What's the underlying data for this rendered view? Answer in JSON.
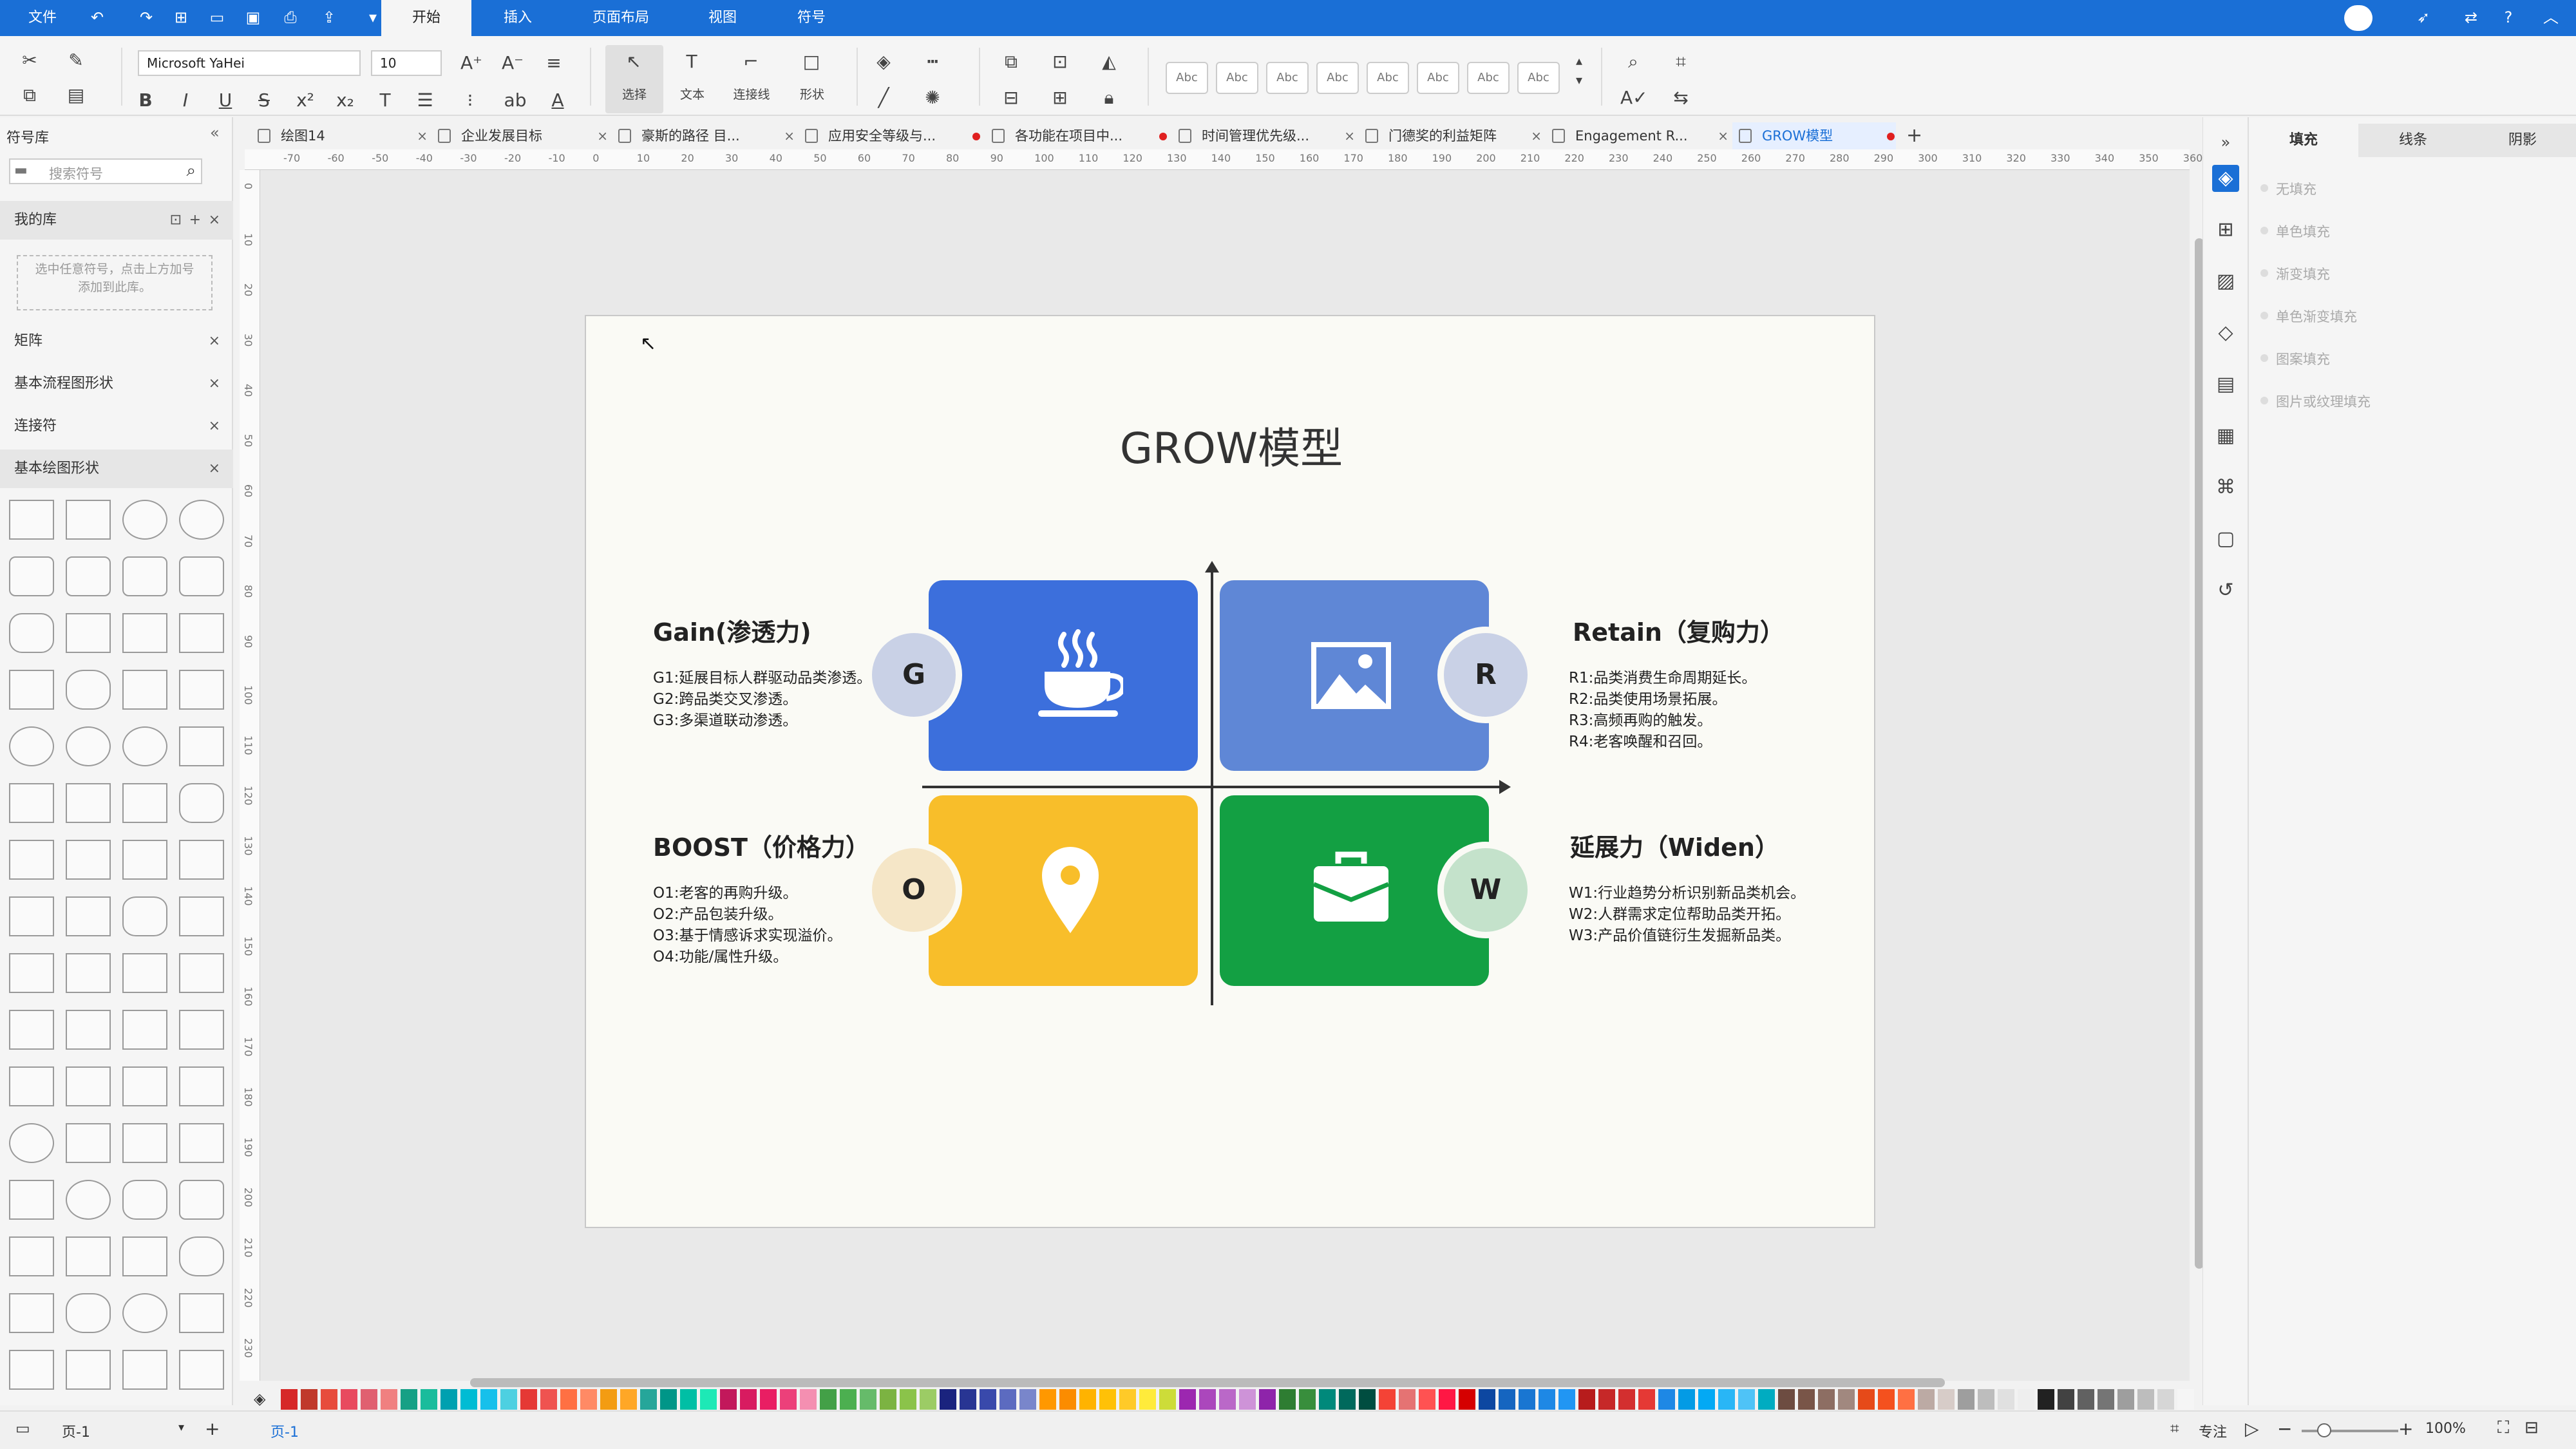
{
  "menu": {
    "file": "文件",
    "tabs": [
      "开始",
      "插入",
      "页面布局",
      "视图",
      "符号"
    ]
  },
  "ribbon": {
    "font_name": "Microsoft YaHei",
    "font_size": "10",
    "tools": [
      "选择",
      "文本",
      "连接线",
      "形状"
    ],
    "style_samples": [
      "Abc",
      "Abc",
      "Abc",
      "Abc",
      "Abc",
      "Abc",
      "Abc",
      "Abc"
    ]
  },
  "left_panel": {
    "title": "符号库",
    "search_placeholder": "搜索符号",
    "my_library": "我的库",
    "library_hint": "选中任意符号，点击上方加号添加到此库。",
    "sections": [
      "矩阵",
      "基本流程图形状",
      "连接符",
      "基本绘图形状"
    ]
  },
  "document_tabs": [
    {
      "label": "绘图14",
      "modified": false
    },
    {
      "label": "企业发展目标",
      "modified": false
    },
    {
      "label": "豪斯的路径 目...",
      "modified": false
    },
    {
      "label": "应用安全等级与...",
      "modified": true
    },
    {
      "label": "各功能在项目中...",
      "modified": true
    },
    {
      "label": "时间管理优先级...",
      "modified": false
    },
    {
      "label": "门德奖的利益矩阵",
      "modified": false
    },
    {
      "label": "Engagement R...",
      "modified": false
    },
    {
      "label": "GROW模型",
      "modified": true,
      "active": true
    }
  ],
  "ruler_marks": [
    "-70",
    "-60",
    "-50",
    "-40",
    "-30",
    "-20",
    "-10",
    "0",
    "10",
    "20",
    "30",
    "40",
    "50",
    "60",
    "70",
    "80",
    "90",
    "100",
    "110",
    "120",
    "130",
    "140",
    "150",
    "160",
    "170",
    "180",
    "190",
    "200",
    "210",
    "220",
    "230",
    "240",
    "250",
    "260",
    "270",
    "280",
    "290",
    "300",
    "310",
    "320",
    "330",
    "340",
    "350",
    "360"
  ],
  "vruler_marks": [
    "0",
    "10",
    "20",
    "30",
    "40",
    "50",
    "60",
    "70",
    "80",
    "90",
    "100",
    "110",
    "120",
    "130",
    "140",
    "150",
    "160",
    "170",
    "180",
    "190",
    "200",
    "210",
    "220",
    "230"
  ],
  "diagram": {
    "title": "GROW模型",
    "quadrants": [
      {
        "letter": "G",
        "color": "#3c6fdc",
        "icon": "coffee-cup-icon",
        "circle_color": "#c9d1e6",
        "heading": "Gain(渗透力)",
        "lines": [
          "G1:延展目标人群驱动品类渗透。",
          "G2:跨品类交叉渗透。",
          "G3:多渠道联动渗透。"
        ]
      },
      {
        "letter": "R",
        "color": "#5f87d6",
        "icon": "image-icon",
        "circle_color": "#c9d1e6",
        "heading": "Retain（复购力）",
        "lines": [
          "R1:品类消费生命周期延长。",
          "R2:品类使用场景拓展。",
          "R3:高频再购的触发。",
          "R4:老客唤醒和召回。"
        ]
      },
      {
        "letter": "O",
        "color": "#f8be2a",
        "icon": "location-pin-icon",
        "circle_color": "#f5e6c7",
        "heading": "BOOST（价格力）",
        "lines": [
          "O1:老客的再购升级。",
          "O2:产品包装升级。",
          "O3:基于情感诉求实现溢价。",
          "O4:功能/属性升级。"
        ]
      },
      {
        "letter": "W",
        "color": "#13a043",
        "icon": "briefcase-icon",
        "circle_color": "#c4e2cb",
        "heading": "延展力（Widen）",
        "lines": [
          "W1:行业趋势分析识别新品类机会。",
          "W2:人群需求定位帮助品类开拓。",
          "W3:产品价值链衍生发掘新品类。"
        ]
      }
    ]
  },
  "right_panel": {
    "tabs": [
      "填充",
      "线条",
      "阴影"
    ],
    "fill_options": [
      "无填充",
      "单色填充",
      "渐变填充",
      "单色渐变填充",
      "图案填充",
      "图片或纹理填充"
    ]
  },
  "status": {
    "page_selector": "页-1",
    "page_tab": "页-1",
    "focus_label": "专注",
    "zoom": "100%"
  },
  "palette": [
    "#d62828",
    "#c0392b",
    "#e74c3c",
    "#e84a5f",
    "#e06070",
    "#f08080",
    "#16a085",
    "#1abc9c",
    "#00a0b0",
    "#00bcd4",
    "#17c0eb",
    "#4dd0e1",
    "#e53935",
    "#ef5350",
    "#ff7043",
    "#ff8a65",
    "#f39c12",
    "#ffa726",
    "#26a69a",
    "#009688",
    "#00bfa5",
    "#1de9b6",
    "#c2185b",
    "#d81b60",
    "#e91e63",
    "#ec407a",
    "#f48fb1",
    "#43a047",
    "#4caf50",
    "#66bb6a",
    "#7cb342",
    "#8bc34a",
    "#9ccc65",
    "#1a237e",
    "#283593",
    "#3949ab",
    "#5c6bc0",
    "#7986cb",
    "#ff9800",
    "#fb8c00",
    "#ffb300",
    "#ffc107",
    "#ffca28",
    "#ffeb3b",
    "#cddc39",
    "#9c27b0",
    "#ab47bc",
    "#ba68c8",
    "#ce93d8",
    "#8e24aa",
    "#2e7d32",
    "#388e3c",
    "#00897b",
    "#00695c",
    "#004d40",
    "#f44336",
    "#e57373",
    "#ff5252",
    "#ff1744",
    "#d50000",
    "#0d47a1",
    "#1565c0",
    "#1976d2",
    "#1e88e5",
    "#2196f3",
    "#b71c1c",
    "#c62828",
    "#d32f2f",
    "#e53935",
    "#1e88e5",
    "#039be5",
    "#03a9f4",
    "#29b6f6",
    "#4fc3f7",
    "#00acc1",
    "#6d4c41",
    "#795548",
    "#8d6e63",
    "#a1887f",
    "#e64a19",
    "#f4511e",
    "#ff7043",
    "#bcaaa4",
    "#d7ccc8",
    "#9e9e9e",
    "#bdbdbd",
    "#e0e0e0",
    "#eeeeee",
    "#212121",
    "#424242",
    "#616161",
    "#757575",
    "#9e9e9e",
    "#bdbdbd",
    "#d6d6d6",
    "#f5f5f5"
  ]
}
